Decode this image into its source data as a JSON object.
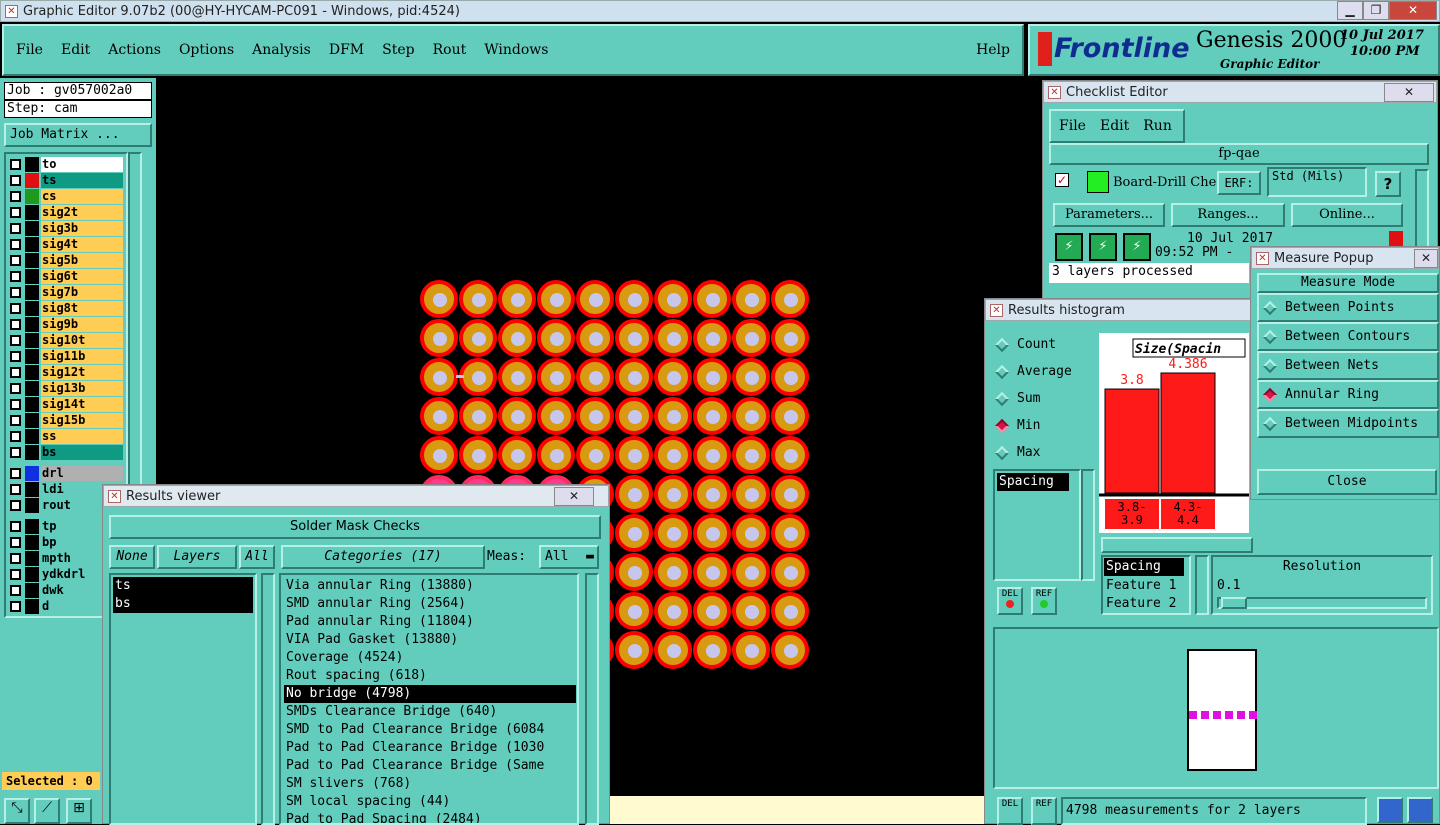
{
  "window": {
    "title": "Graphic Editor 9.07b2 (00@HY-HYCAM-PC091 - Windows, pid:4524)"
  },
  "menu": [
    "File",
    "Edit",
    "Actions",
    "Options",
    "Analysis",
    "DFM",
    "Step",
    "Rout",
    "Windows"
  ],
  "help": "Help",
  "brand": {
    "logo": "Frontline",
    "product": "Genesis 2000",
    "subtitle": "Graphic Editor",
    "date": "10 Jul 2017",
    "time": "10:00 PM"
  },
  "job": {
    "job": "Job : gv057002a0",
    "step": "Step: cam",
    "matrix": "Job Matrix ..."
  },
  "layers": [
    {
      "name": "to",
      "color": "#ffffff",
      "swatch": "#000000"
    },
    {
      "name": "ts",
      "color": "#0f9a84",
      "swatch": "#e01010"
    },
    {
      "name": "cs",
      "color": "#ffcc55",
      "swatch": "#1f9a1f"
    },
    {
      "name": "sig2t",
      "color": "#ffcc55",
      "swatch": "#000000"
    },
    {
      "name": "sig3b",
      "color": "#ffcc55",
      "swatch": "#000000"
    },
    {
      "name": "sig4t",
      "color": "#ffcc55",
      "swatch": "#000000"
    },
    {
      "name": "sig5b",
      "color": "#ffcc55",
      "swatch": "#000000"
    },
    {
      "name": "sig6t",
      "color": "#ffcc55",
      "swatch": "#000000"
    },
    {
      "name": "sig7b",
      "color": "#ffcc55",
      "swatch": "#000000"
    },
    {
      "name": "sig8t",
      "color": "#ffcc55",
      "swatch": "#000000"
    },
    {
      "name": "sig9b",
      "color": "#ffcc55",
      "swatch": "#000000"
    },
    {
      "name": "sig10t",
      "color": "#ffcc55",
      "swatch": "#000000"
    },
    {
      "name": "sig11b",
      "color": "#ffcc55",
      "swatch": "#000000"
    },
    {
      "name": "sig12t",
      "color": "#ffcc55",
      "swatch": "#000000"
    },
    {
      "name": "sig13b",
      "color": "#ffcc55",
      "swatch": "#000000"
    },
    {
      "name": "sig14t",
      "color": "#ffcc55",
      "swatch": "#000000"
    },
    {
      "name": "sig15b",
      "color": "#ffcc55",
      "swatch": "#000000"
    },
    {
      "name": "ss",
      "color": "#ffcc55",
      "swatch": "#000000"
    },
    {
      "name": "bs",
      "color": "#0f9a84",
      "swatch": "#000000"
    }
  ],
  "drill_layers": [
    {
      "name": "drl",
      "color": "#b0b0b0",
      "swatch": "#1030e0"
    },
    {
      "name": "ldi",
      "color": "#63cdbd",
      "swatch": "#000000"
    },
    {
      "name": "rout",
      "color": "#63cdbd",
      "swatch": "#000000"
    }
  ],
  "misc_layers": [
    "tp",
    "bp",
    "mpth",
    "ydkdrl",
    "dwk",
    "d"
  ],
  "selected": "Selected : 0",
  "results_viewer": {
    "title": "Results viewer",
    "heading": "Solder Mask Checks",
    "none": "None",
    "layers": "Layers",
    "all": "All",
    "categories": "Categories (17)",
    "meas_label": "Meas:",
    "meas_value": "All",
    "layer_items": [
      "ts",
      "bs"
    ],
    "category_items": [
      "Via annular Ring (13880)",
      "SMD annular Ring (2564)",
      "Pad annular Ring (11804)",
      "VIA Pad Gasket (13880)",
      "Coverage (4524)",
      "Rout spacing (618)",
      "No bridge (4798)",
      "SMDs Clearance Bridge (640)",
      "SMD to Pad Clearance Bridge (6084",
      "Pad to Pad Clearance Bridge (1030",
      "Pad to Pad Clearance Bridge (Same",
      "SM slivers (768)",
      "SM local spacing (44)",
      "Pad to Pad Spacing (2484)"
    ]
  },
  "checklist": {
    "title": "Checklist Editor",
    "menu": [
      "File",
      "Edit",
      "Run"
    ],
    "name": "fp-qae",
    "action": "Board-Drill Che",
    "erf": "ERF:",
    "units": "Std (Mils)",
    "q": "?",
    "parameters": "Parameters...",
    "ranges": "Ranges...",
    "online": "Online...",
    "date": "10 Jul 2017",
    "time": "09:52 PM -",
    "status": "3 layers processed"
  },
  "histogram": {
    "title": "Results histogram",
    "modes": [
      "Count",
      "Average",
      "Sum",
      "Min",
      "Max"
    ],
    "selected_mode": "Min",
    "category": "Spacing",
    "chart_title": "Size(Spacin",
    "del": "DEL",
    "ref": "REF",
    "feature_list": [
      "Spacing",
      "Feature 1",
      "Feature 2"
    ],
    "resolution_label": "Resolution",
    "resolution_value": "0.1",
    "footer": "4798 measurements for 2 layers"
  },
  "chart_data": {
    "type": "bar",
    "title": "Size(Spacin",
    "categories": [
      "3.8-\n3.9",
      "4.3-\n4.4"
    ],
    "values": [
      3.8,
      4.386
    ],
    "value_labels": [
      "3.8",
      "4.386"
    ],
    "ylim": [
      0,
      4.386
    ]
  },
  "measure": {
    "title": "Measure Popup",
    "heading": "Measure Mode",
    "options": [
      "Between Points",
      "Between Contours",
      "Between Nets",
      "Annular Ring",
      "Between Midpoints"
    ],
    "selected": "Annular Ring",
    "close": "Close"
  }
}
